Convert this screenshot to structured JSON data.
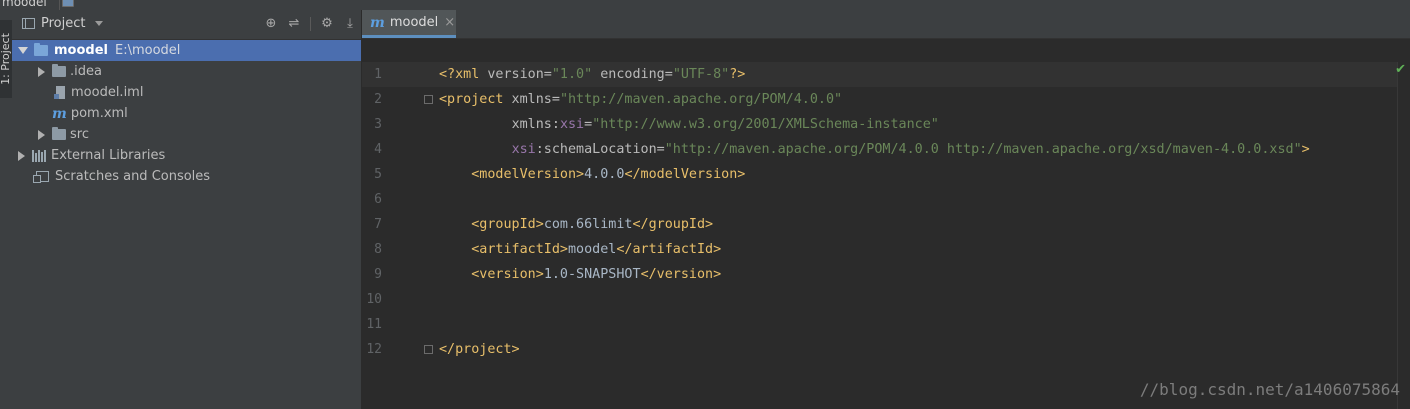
{
  "window": {
    "crumb": "moodel"
  },
  "toolstrip": {
    "project_tab": "1: Project"
  },
  "project_panel": {
    "title": "Project",
    "tools": [
      "⊕",
      "⇌",
      "⚙",
      "⤓"
    ],
    "tree": {
      "root": {
        "label": "moodel",
        "path": "E:\\moodel"
      },
      "idea": "idea_label",
      "items": [
        {
          "label": ".idea"
        },
        {
          "label": "moodel.iml"
        },
        {
          "label": "pom.xml"
        },
        {
          "label": "src"
        }
      ],
      "external_libraries": "External Libraries",
      "scratches": "Scratches and Consoles"
    }
  },
  "editor": {
    "tab": {
      "label": "moodel",
      "close": "×"
    },
    "line_numbers": [
      "1",
      "2",
      "3",
      "4",
      "5",
      "6",
      "7",
      "8",
      "9",
      "10",
      "11",
      "12"
    ],
    "code": {
      "l1": {
        "open": "<?",
        "name": "xml",
        "a1": " version=",
        "v1": "\"1.0\"",
        "a2": " encoding=",
        "v2": "\"UTF-8\"",
        "close": "?>"
      },
      "l2": {
        "open": "<project",
        "a1": " xmlns=",
        "v1": "\"http://maven.apache.org/POM/4.0.0\""
      },
      "l3": {
        "indent": "         ",
        "a1": "xmlns:",
        "ns": "xsi",
        "eq": "=",
        "v1": "\"http://www.w3.org/2001/XMLSchema-instance\""
      },
      "l4": {
        "indent": "         ",
        "ns": "xsi",
        "a1": ":schemaLocation=",
        "v1": "\"http://maven.apache.org/POM/4.0.0 http://maven.apache.org/xsd/maven-4.0.0.xsd\"",
        "close": ">"
      },
      "l5": {
        "indent": "    ",
        "open": "<modelVersion>",
        "text": "4.0.0",
        "close": "</modelVersion>"
      },
      "l7": {
        "indent": "    ",
        "open": "<groupId>",
        "text": "com.66limit",
        "close": "</groupId>"
      },
      "l8": {
        "indent": "    ",
        "open": "<artifactId>",
        "text": "moodel",
        "close": "</artifactId>"
      },
      "l9": {
        "indent": "    ",
        "open": "<version>",
        "text": "1.0-SNAPSHOT",
        "close": "</version>"
      },
      "l12": {
        "close": "</project>"
      }
    },
    "status_mark": "✔"
  },
  "watermark": "//blog.csdn.net/a1406075864"
}
